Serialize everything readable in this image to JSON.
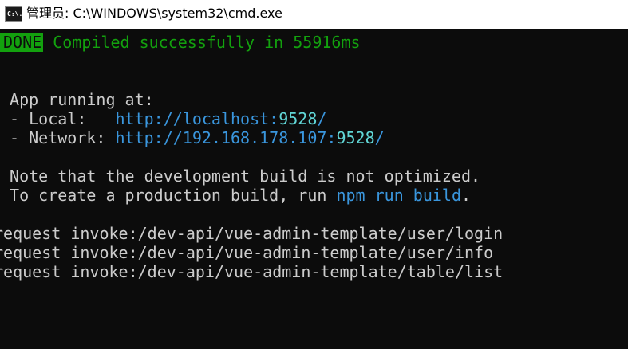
{
  "window": {
    "icon_text": "C:\\.",
    "title": "管理员: C:\\WINDOWS\\system32\\cmd.exe"
  },
  "console": {
    "done_badge": "DONE",
    "compiled_message": "Compiled successfully in 55916ms",
    "app_running": "App running at:",
    "local_label": "- Local:   ",
    "local_url_prefix": "http://localhost:",
    "local_port": "9528",
    "local_url_suffix": "/",
    "network_label": "- Network: ",
    "network_url_prefix": "http://192.168.178.107:",
    "network_port": "9528",
    "network_url_suffix": "/",
    "note_line": "Note that the development build is not optimized.",
    "create_prefix": "To create a production build, run ",
    "create_command": "npm run build",
    "create_suffix": ".",
    "requests": [
      "request invoke:/dev-api/vue-admin-template/user/login",
      "request invoke:/dev-api/vue-admin-template/user/info",
      "request invoke:/dev-api/vue-admin-template/table/list"
    ]
  },
  "colors": {
    "background": "#0c0c0c",
    "text": "#cccccc",
    "success_green": "#13a10e",
    "url_blue": "#3a96dd",
    "port_cyan": "#61d6d6"
  }
}
